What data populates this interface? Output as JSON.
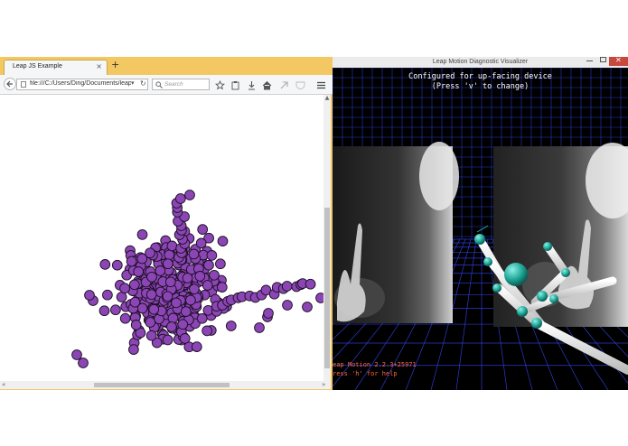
{
  "browser": {
    "tab_title": "Leap JS Example",
    "tab_close": "×",
    "new_tab": "+",
    "url": "file:///C:/Users/Ding/Documents/leap-m",
    "search_placeholder": "Search",
    "content_bg": "#ffffff",
    "particle_color": "#8b45b4"
  },
  "visualizer": {
    "window_title": "Leap Motion Diagnostic Visualizer",
    "message_line1": "Configured for up-facing device",
    "message_line2": "(Press 'v' to change)",
    "version_text": "eap Motion 2.2.3+25971",
    "help_text": "ress 'h' for help",
    "grid_color": "#2f3fd8",
    "overlay_text_color": "#ff6640",
    "joint_color": "#1fa89a"
  },
  "colors": {
    "window_frame": "#f3c762",
    "close_button": "#c8483e"
  }
}
